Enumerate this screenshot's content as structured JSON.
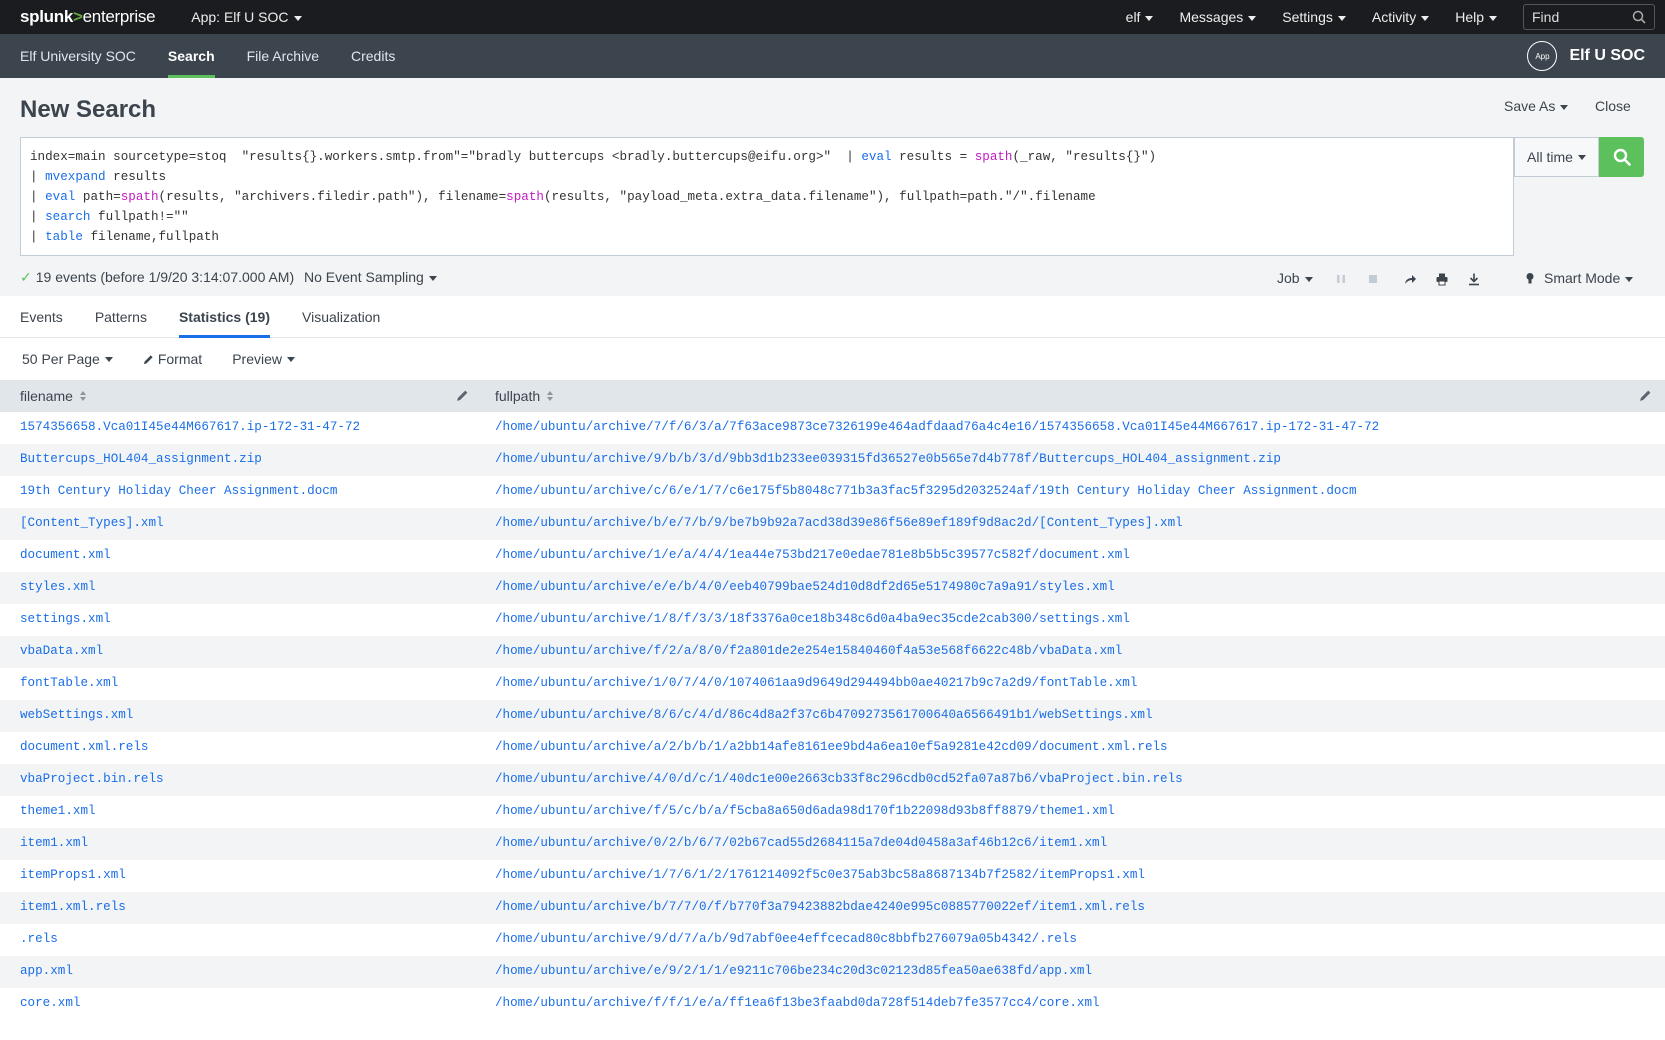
{
  "sysbar": {
    "logo_main": "splunk",
    "logo_gt": ">",
    "logo_sub": "enterprise",
    "app_menu": "App: Elf U SOC",
    "user": "elf",
    "messages": "Messages",
    "settings": "Settings",
    "activity": "Activity",
    "help": "Help",
    "find_placeholder": "Find"
  },
  "appbar": {
    "nav": [
      "Elf University SOC",
      "Search",
      "File Archive",
      "Credits"
    ],
    "active_index": 1,
    "badge": "App",
    "app_name": "Elf U SOC"
  },
  "search": {
    "title": "New Search",
    "save_as": "Save As",
    "close": "Close",
    "time_range": "All time",
    "status": "19 events (before 1/9/20 3:14:07.000 AM)",
    "sampling": "No Event Sampling",
    "job": "Job",
    "mode": "Smart Mode"
  },
  "tabs": [
    "Events",
    "Patterns",
    "Statistics (19)",
    "Visualization"
  ],
  "controls": {
    "per_page": "50 Per Page",
    "format": "Format",
    "preview": "Preview"
  },
  "table": {
    "columns": [
      "filename",
      "fullpath"
    ],
    "rows": [
      [
        "1574356658.Vca01I45e44M667617.ip-172-31-47-72",
        "/home/ubuntu/archive/7/f/6/3/a/7f63ace9873ce7326199e464adfdaad76a4c4e16/1574356658.Vca01I45e44M667617.ip-172-31-47-72"
      ],
      [
        "Buttercups_HOL404_assignment.zip",
        "/home/ubuntu/archive/9/b/b/3/d/9bb3d1b233ee039315fd36527e0b565e7d4b778f/Buttercups_HOL404_assignment.zip"
      ],
      [
        "19th Century Holiday Cheer Assignment.docm",
        "/home/ubuntu/archive/c/6/e/1/7/c6e175f5b8048c771b3a3fac5f3295d2032524af/19th Century Holiday Cheer Assignment.docm"
      ],
      [
        "[Content_Types].xml",
        "/home/ubuntu/archive/b/e/7/b/9/be7b9b92a7acd38d39e86f56e89ef189f9d8ac2d/[Content_Types].xml"
      ],
      [
        "document.xml",
        "/home/ubuntu/archive/1/e/a/4/4/1ea44e753bd217e0edae781e8b5b5c39577c582f/document.xml"
      ],
      [
        "styles.xml",
        "/home/ubuntu/archive/e/e/b/4/0/eeb40799bae524d10d8df2d65e5174980c7a9a91/styles.xml"
      ],
      [
        "settings.xml",
        "/home/ubuntu/archive/1/8/f/3/3/18f3376a0ce18b348c6d0a4ba9ec35cde2cab300/settings.xml"
      ],
      [
        "vbaData.xml",
        "/home/ubuntu/archive/f/2/a/8/0/f2a801de2e254e15840460f4a53e568f6622c48b/vbaData.xml"
      ],
      [
        "fontTable.xml",
        "/home/ubuntu/archive/1/0/7/4/0/1074061aa9d9649d294494bb0ae40217b9c7a2d9/fontTable.xml"
      ],
      [
        "webSettings.xml",
        "/home/ubuntu/archive/8/6/c/4/d/86c4d8a2f37c6b4709273561700640a6566491b1/webSettings.xml"
      ],
      [
        "document.xml.rels",
        "/home/ubuntu/archive/a/2/b/b/1/a2bb14afe8161ee9bd4a6ea10ef5a9281e42cd09/document.xml.rels"
      ],
      [
        "vbaProject.bin.rels",
        "/home/ubuntu/archive/4/0/d/c/1/40dc1e00e2663cb33f8c296cdb0cd52fa07a87b6/vbaProject.bin.rels"
      ],
      [
        "theme1.xml",
        "/home/ubuntu/archive/f/5/c/b/a/f5cba8a650d6ada98d170f1b22098d93b8ff8879/theme1.xml"
      ],
      [
        "item1.xml",
        "/home/ubuntu/archive/0/2/b/6/7/02b67cad55d2684115a7de04d0458a3af46b12c6/item1.xml"
      ],
      [
        "itemProps1.xml",
        "/home/ubuntu/archive/1/7/6/1/2/1761214092f5c0e375ab3bc58a8687134b7f2582/itemProps1.xml"
      ],
      [
        "item1.xml.rels",
        "/home/ubuntu/archive/b/7/7/0/f/b770f3a79423882bdae4240e995c0885770022ef/item1.xml.rels"
      ],
      [
        ".rels",
        "/home/ubuntu/archive/9/d/7/a/b/9d7abf0ee4effcecad80c8bbfb276079a05b4342/.rels"
      ],
      [
        "app.xml",
        "/home/ubuntu/archive/e/9/2/1/1/e9211c706be234c20d3c02123d85fea50ae638fd/app.xml"
      ],
      [
        "core.xml",
        "/home/ubuntu/archive/f/f/1/e/a/ff1ea6f13be3faabd0da728f514deb7fe3577cc4/core.xml"
      ]
    ]
  },
  "colors": {
    "sysbar_bg": "#1a1c20",
    "appbar_bg": "#3c444d",
    "accent_green": "#5cc05c",
    "link_blue": "#1a6ee8",
    "keyword_blue": "#1a6ee8",
    "function_magenta": "#c21bc0"
  },
  "icons": {
    "find": "search-icon",
    "search_button": "search-icon",
    "pause": "pause-icon",
    "stop": "stop-icon",
    "share": "share-icon",
    "print": "print-icon",
    "export": "download-icon",
    "mode": "lightbulb-icon",
    "format": "pencil-icon",
    "sort": "sort-icon",
    "column_edit": "pencil-icon"
  }
}
